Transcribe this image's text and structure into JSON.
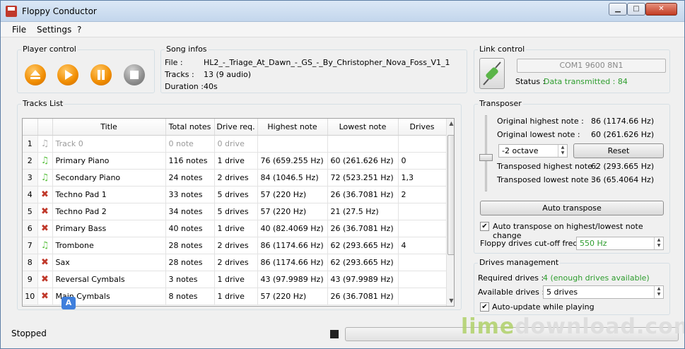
{
  "window": {
    "title": "Floppy Conductor",
    "min_glyph": "▁",
    "max_glyph": "□",
    "close_glyph": "✕"
  },
  "menu": [
    "File",
    "Settings",
    "?"
  ],
  "player": {
    "label": "Player control"
  },
  "song": {
    "label": "Song infos",
    "file_label": "File :",
    "file_value": "HL2_-_Triage_At_Dawn_-_GS_-_By_Christopher_Nova_Foss_V1_1",
    "tracks_label": "Tracks :",
    "tracks_value": "13 (9 audio)",
    "duration_label": "Duration :",
    "duration_value": "40s"
  },
  "link": {
    "label": "Link control",
    "com_value": "COM1 9600 8N1",
    "status_label": "Status :",
    "status_value": "Data transmitted : 84"
  },
  "tracks": {
    "label": "Tracks List",
    "columns": [
      "",
      "",
      "Title",
      "Total notes",
      "Drive req.",
      "Highest note",
      "Lowest note",
      "Drives"
    ],
    "rows": [
      {
        "n": "1",
        "icon": "muted-music-note-icon",
        "title": "Track 0",
        "total": "0 note",
        "drive_req": "0 drive",
        "highest": "",
        "lowest": "",
        "drives": ""
      },
      {
        "n": "2",
        "icon": "music-note-icon",
        "title": "Primary Piano",
        "total": "116 notes",
        "drive_req": "1 drive",
        "highest": "76 (659.255 Hz)",
        "lowest": "60 (261.626 Hz)",
        "drives": "0"
      },
      {
        "n": "3",
        "icon": "music-note-icon",
        "title": "Secondary Piano",
        "total": "24 notes",
        "drive_req": "2 drives",
        "highest": "84 (1046.5 Hz)",
        "lowest": "72 (523.251 Hz)",
        "drives": "1,3"
      },
      {
        "n": "4",
        "icon": "disabled-x-icon",
        "title": "Techno Pad 1",
        "total": "33 notes",
        "drive_req": "5 drives",
        "highest": "57 (220 Hz)",
        "lowest": "26 (36.7081 Hz)",
        "drives": "2"
      },
      {
        "n": "5",
        "icon": "disabled-x-icon",
        "title": "Techno Pad 2",
        "total": "34 notes",
        "drive_req": "5 drives",
        "highest": "57 (220 Hz)",
        "lowest": "21 (27.5 Hz)",
        "drives": ""
      },
      {
        "n": "6",
        "icon": "disabled-x-icon",
        "title": "Primary Bass",
        "total": "40 notes",
        "drive_req": "1 drive",
        "highest": "40 (82.4069 Hz)",
        "lowest": "26 (36.7081 Hz)",
        "drives": ""
      },
      {
        "n": "7",
        "icon": "music-note-icon",
        "title": "Trombone",
        "total": "28 notes",
        "drive_req": "2 drives",
        "highest": "86 (1174.66 Hz)",
        "lowest": "62 (293.665 Hz)",
        "drives": "4"
      },
      {
        "n": "8",
        "icon": "disabled-x-icon",
        "title": "Sax",
        "total": "28 notes",
        "drive_req": "2 drives",
        "highest": "86 (1174.66 Hz)",
        "lowest": "62 (293.665 Hz)",
        "drives": ""
      },
      {
        "n": "9",
        "icon": "disabled-x-icon",
        "title": "Reversal Cymbals",
        "total": "3 notes",
        "drive_req": "1 drive",
        "highest": "43 (97.9989 Hz)",
        "lowest": "43 (97.9989 Hz)",
        "drives": ""
      },
      {
        "n": "10",
        "icon": "disabled-x-icon",
        "title": "Main Cymbals",
        "total": "8 notes",
        "drive_req": "1 drive",
        "highest": "57 (220 Hz)",
        "lowest": "26 (36.7081 Hz)",
        "drives": ""
      }
    ]
  },
  "transposer": {
    "label": "Transposer",
    "orig_high_label": "Original highest note :",
    "orig_high_value": "86 (1174.66 Hz)",
    "orig_low_label": "Original lowest note :",
    "orig_low_value": "60 (261.626 Hz)",
    "octave_value": "-2 octave",
    "reset_label": "Reset",
    "trans_high_label": "Transposed highest note :",
    "trans_high_value": "62 (293.665 Hz)",
    "trans_low_label": "Transposed lowest note :",
    "trans_low_value": "36 (65.4064 Hz)",
    "auto_transpose_label": "Auto transpose",
    "auto_change_label": "Auto transpose on highest/lowest note change",
    "auto_change_checked": true,
    "cutoff_label": "Floppy drives cut-off freq :",
    "cutoff_value": "550 Hz"
  },
  "drives": {
    "label": "Drives management",
    "required_label": "Required drives :",
    "required_value": "4 (enough drives available)",
    "available_label": "Available drives :",
    "available_value": "5 drives",
    "auto_update_label": "Auto-update while playing",
    "auto_update_checked": true
  },
  "status": {
    "text": "Stopped",
    "progress": 0
  },
  "watermark": {
    "brand": "lime",
    "rest": "download.com"
  },
  "colors": {
    "accent_orange": "#f08c00",
    "status_green": "#2e9d2e",
    "close_red": "#c23b22"
  }
}
